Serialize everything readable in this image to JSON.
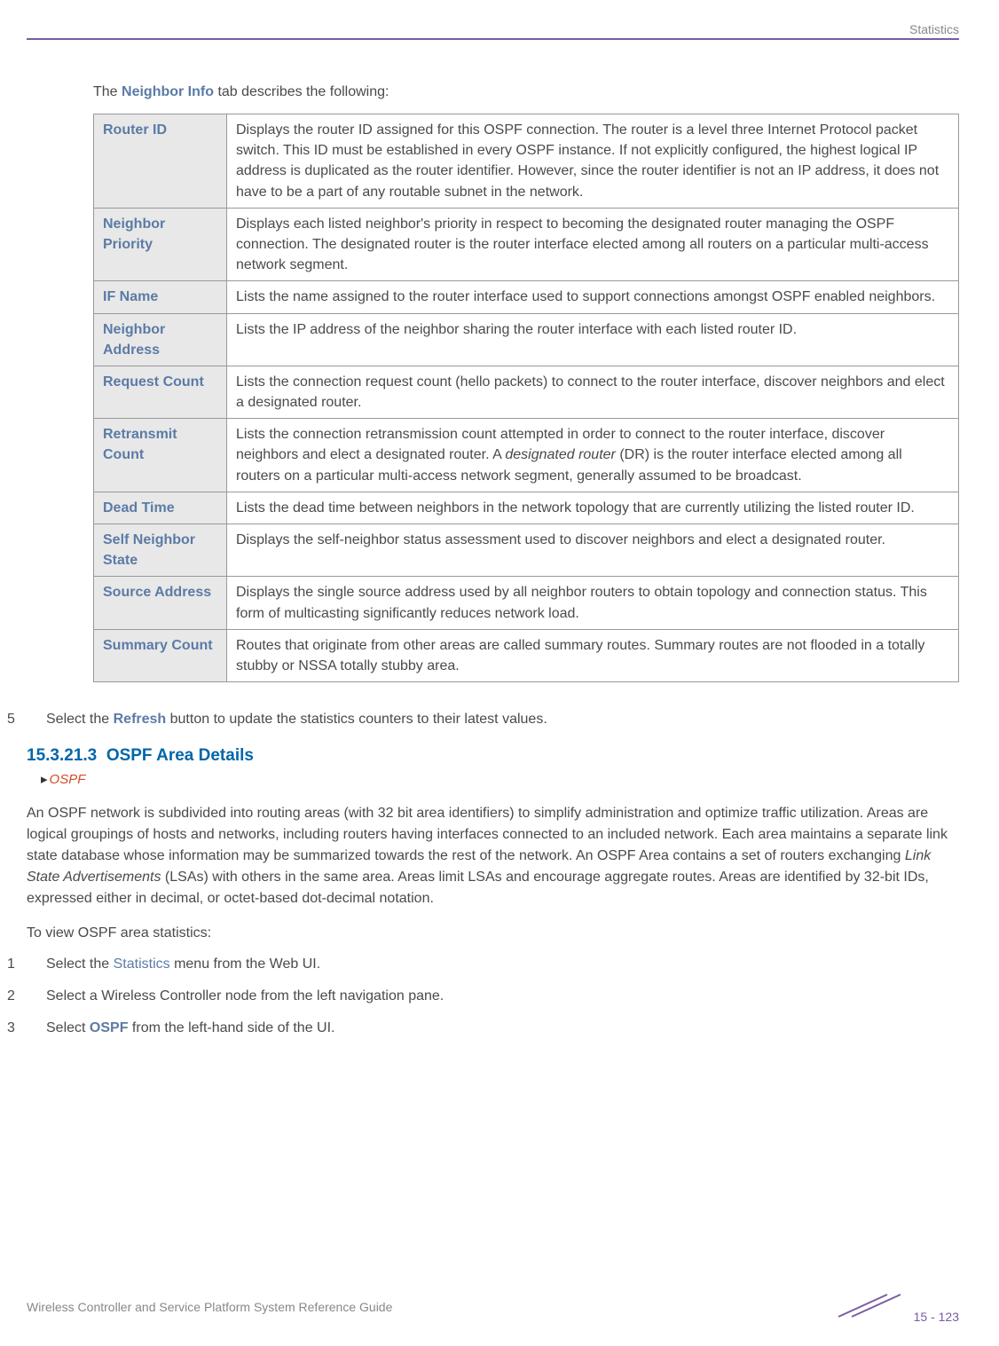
{
  "header": {
    "section_label": "Statistics"
  },
  "intro": {
    "prefix": "The ",
    "bold": "Neighbor Info",
    "suffix": " tab describes the following:"
  },
  "table": [
    {
      "term": "Router ID",
      "desc": "Displays the router ID assigned for this OSPF connection. The router is a level three Internet Protocol packet switch. This ID must be established in every OSPF instance. If not explicitly configured, the highest logical IP address is duplicated as the router identifier. However, since the router identifier is not an IP address, it does not have to be a part of any routable subnet in the network."
    },
    {
      "term": "Neighbor Priority",
      "desc": "Displays each listed neighbor's priority in respect to becoming the designated router managing the OSPF connection. The designated router is the router interface elected among all routers on a particular multi-access network segment."
    },
    {
      "term": "IF Name",
      "desc": "Lists the name assigned to the router interface used to support connections amongst OSPF enabled neighbors."
    },
    {
      "term": "Neighbor Address",
      "desc": "Lists the IP address of the neighbor sharing the router interface with each listed router ID."
    },
    {
      "term": "Request Count",
      "desc": "Lists the connection request count (hello packets) to connect to the router interface, discover neighbors and elect a designated router."
    },
    {
      "term": "Retransmit Count",
      "desc_pre": "Lists the connection retransmission count attempted in order to connect to the router interface, discover neighbors and elect a designated router. A ",
      "desc_italic": "designated router",
      "desc_post": " (DR) is the router interface elected among all routers on a particular multi-access network segment, generally assumed to be broadcast."
    },
    {
      "term": "Dead Time",
      "desc": "Lists the dead time between neighbors in the network topology that are currently utilizing the listed router ID."
    },
    {
      "term": "Self Neighbor State",
      "desc": "Displays the self-neighbor status assessment used to discover neighbors and elect a designated router."
    },
    {
      "term": "Source Address",
      "desc": "Displays the single source address used by all neighbor routers to obtain topology and connection status. This form of multicasting significantly reduces network load."
    },
    {
      "term": "Summary Count",
      "desc": "Routes that originate from other areas are called summary routes. Summary routes are not flooded in a totally stubby or NSSA totally stubby area."
    }
  ],
  "step5": {
    "num": "5",
    "pre": "Select the ",
    "bold": "Refresh",
    "post": " button to update the statistics counters to their latest values."
  },
  "section": {
    "number": "15.3.21.3",
    "title": "OSPF Area Details",
    "breadcrumb": "OSPF"
  },
  "para1": {
    "pre": "An OSPF network is subdivided into routing areas (with 32 bit area identifiers) to simplify administration and optimize traffic utilization. Areas are logical groupings of hosts and networks, including routers having interfaces connected to an included network. Each area maintains a separate link state database whose information may be summarized towards the rest of the network. An OSPF Area contains a set of routers exchanging ",
    "italic": "Link State Advertisements",
    "post": " (LSAs) with others in the same area. Areas limit LSAs and encourage aggregate routes. Areas are identified by 32-bit IDs, expressed either in decimal, or octet-based dot-decimal notation."
  },
  "steps_intro": "To view OSPF area statistics:",
  "steps": [
    {
      "num": "1",
      "pre": "Select the ",
      "link": "Statistics",
      "post": " menu from the Web UI."
    },
    {
      "num": "2",
      "text": "Select a Wireless Controller node from the left navigation pane."
    },
    {
      "num": "3",
      "pre": "Select ",
      "bold": "OSPF",
      "post": " from the left-hand side of the UI."
    }
  ],
  "footer": {
    "guide_title": "Wireless Controller and Service Platform System Reference Guide",
    "page": "15 - 123"
  }
}
